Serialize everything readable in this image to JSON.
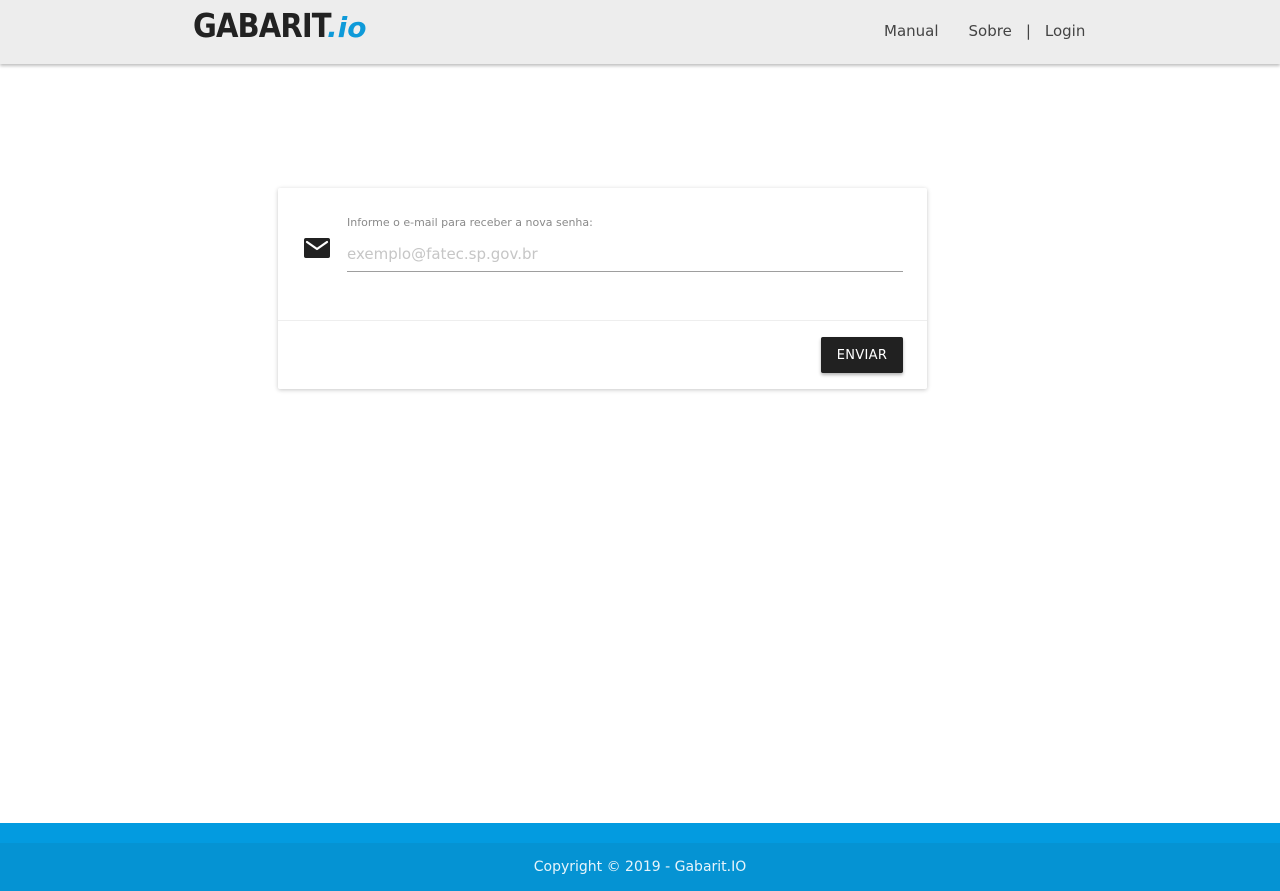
{
  "header": {
    "logo_main": "GABARIT",
    "logo_suffix": ".io",
    "nav": {
      "manual": "Manual",
      "sobre": "Sobre",
      "separator": "|",
      "login": "Login"
    }
  },
  "form": {
    "icon": "mail-icon",
    "label": "Informe o e-mail para receber a nova senha:",
    "email_value": "",
    "email_placeholder": "exemplo@fatec.sp.gov.br",
    "submit_label": "ENVIAR"
  },
  "footer": {
    "copyright": "Copyright © 2019 - Gabarit.IO"
  },
  "colors": {
    "header_bg": "#ededed",
    "brand_blue": "#0e9ad9",
    "button_bg": "#212121",
    "footer_top": "#039be0",
    "footer_bottom": "#0593d3"
  }
}
